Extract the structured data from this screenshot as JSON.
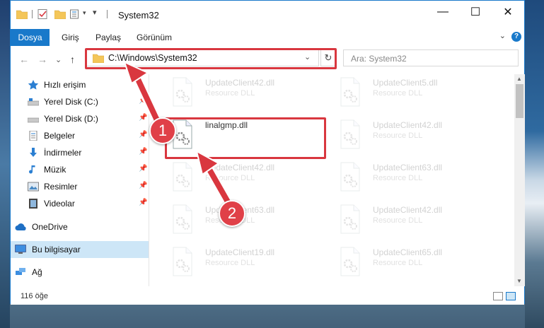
{
  "window": {
    "title": "System32",
    "controls": {
      "minimize": "—",
      "maximize": "☐",
      "close": "✕"
    }
  },
  "ribbon": {
    "tabs": [
      "Dosya",
      "Giriş",
      "Paylaş",
      "Görünüm"
    ],
    "help": "?",
    "expand": "⌄"
  },
  "nav": {
    "back": "←",
    "forward": "→",
    "recent": "⌄",
    "up": "↑"
  },
  "address": {
    "path": "C:\\Windows\\System32",
    "dropdown": "⌄",
    "refresh": "↻"
  },
  "search": {
    "placeholder": "Ara: System32"
  },
  "sidebar": {
    "items": [
      {
        "label": "Hızlı erişim",
        "icon": "star-icon",
        "pinned": false
      },
      {
        "label": "Yerel Disk (C:)",
        "icon": "drive-icon",
        "pinned": true
      },
      {
        "label": "Yerel Disk (D:)",
        "icon": "drive-icon",
        "pinned": true
      },
      {
        "label": "Belgeler",
        "icon": "document-icon",
        "pinned": true
      },
      {
        "label": "İndirmeler",
        "icon": "download-icon",
        "pinned": true
      },
      {
        "label": "Müzik",
        "icon": "music-icon",
        "pinned": true
      },
      {
        "label": "Resimler",
        "icon": "pictures-icon",
        "pinned": true
      },
      {
        "label": "Videolar",
        "icon": "video-icon",
        "pinned": true
      },
      {
        "label": "OneDrive",
        "icon": "cloud-icon",
        "pinned": false
      },
      {
        "label": "Bu bilgisayar",
        "icon": "computer-icon",
        "pinned": false
      },
      {
        "label": "Ağ",
        "icon": "network-icon",
        "pinned": false
      }
    ],
    "pin_glyph": "📌"
  },
  "files": [
    {
      "name": "UpdateClient42.dll",
      "type": "Resource DLL"
    },
    {
      "name": "UpdateClient5.dll",
      "type": "Resource DLL"
    },
    {
      "name": "linalgmp.dll",
      "type": ""
    },
    {
      "name": "UpdateClient42.dll",
      "type": "Resource DLL"
    },
    {
      "name": "UpdateClient42.dll",
      "type": "Resource DLL"
    },
    {
      "name": "UpdateClient63.dll",
      "type": "Resource DLL"
    },
    {
      "name": "UpdateClient63.dll",
      "type": "Resource DLL"
    },
    {
      "name": "UpdateClient42.dll",
      "type": "Resource DLL"
    },
    {
      "name": "UpdateClient19.dll",
      "type": "Resource DLL"
    },
    {
      "name": "UpdateClient65.dll",
      "type": "Resource DLL"
    }
  ],
  "status": {
    "count": "116 öğe"
  },
  "annotations": {
    "badge1": "1",
    "badge2": "2",
    "color": "#d9373f"
  }
}
